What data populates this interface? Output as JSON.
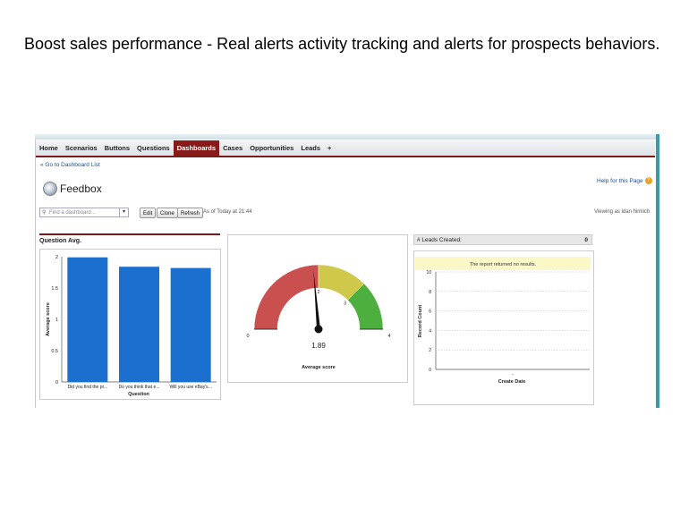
{
  "caption": "Boost sales performance  - Real alerts activity tracking and alerts for prospects behaviors.",
  "nav": {
    "items": [
      "Home",
      "Scenarios",
      "Buttons",
      "Questions",
      "Dashboards",
      "Cases",
      "Opportunities",
      "Leads",
      "+"
    ],
    "active": "Dashboards"
  },
  "back_link": "« Go to Dashboard List",
  "help_link": "Help for this Page",
  "page_title": "Feedbox",
  "search": {
    "placeholder": "Find a dashboard..."
  },
  "buttons": {
    "edit": "Edit",
    "clone": "Clone",
    "refresh": "Refresh"
  },
  "as_of": "As of Today at 21:44",
  "viewing_as": "Viewing as idan himlich",
  "colors": {
    "accent": "#8a1a1a",
    "bar": "#1a6fcf",
    "gauge_red": "#c9504f",
    "gauge_yellow": "#cfc84a",
    "gauge_green": "#4caf3e"
  },
  "chart_data": [
    {
      "type": "bar",
      "title": "Question Avg.",
      "categories": [
        "Did you find the pr...",
        "Do you think that e...",
        "Will you use eBay's..."
      ],
      "values": [
        1.99,
        1.84,
        1.82
      ],
      "xlabel": "Question",
      "ylabel": "Average score",
      "ylim": [
        0,
        2
      ],
      "yticks": [
        "0",
        "0.5",
        "1",
        "1.5",
        "2"
      ]
    },
    {
      "type": "gauge",
      "value": 1.89,
      "value_label": "1.89",
      "min_label": "0",
      "max_label": "4",
      "range": [
        0,
        4
      ],
      "bands": [
        2,
        3,
        4
      ],
      "band_labels": [
        "2",
        "3"
      ],
      "xlabel": "Average score"
    },
    {
      "type": "bar",
      "header": "# Leads Created:",
      "header_value": "0",
      "message": "The report returned no results.",
      "xlabel": "Create Date",
      "ylabel": "Record Count",
      "ylim": [
        0,
        10
      ],
      "yticks": [
        "0",
        "2",
        "4",
        "6",
        "8",
        "10"
      ],
      "categories": [
        "-"
      ]
    }
  ]
}
